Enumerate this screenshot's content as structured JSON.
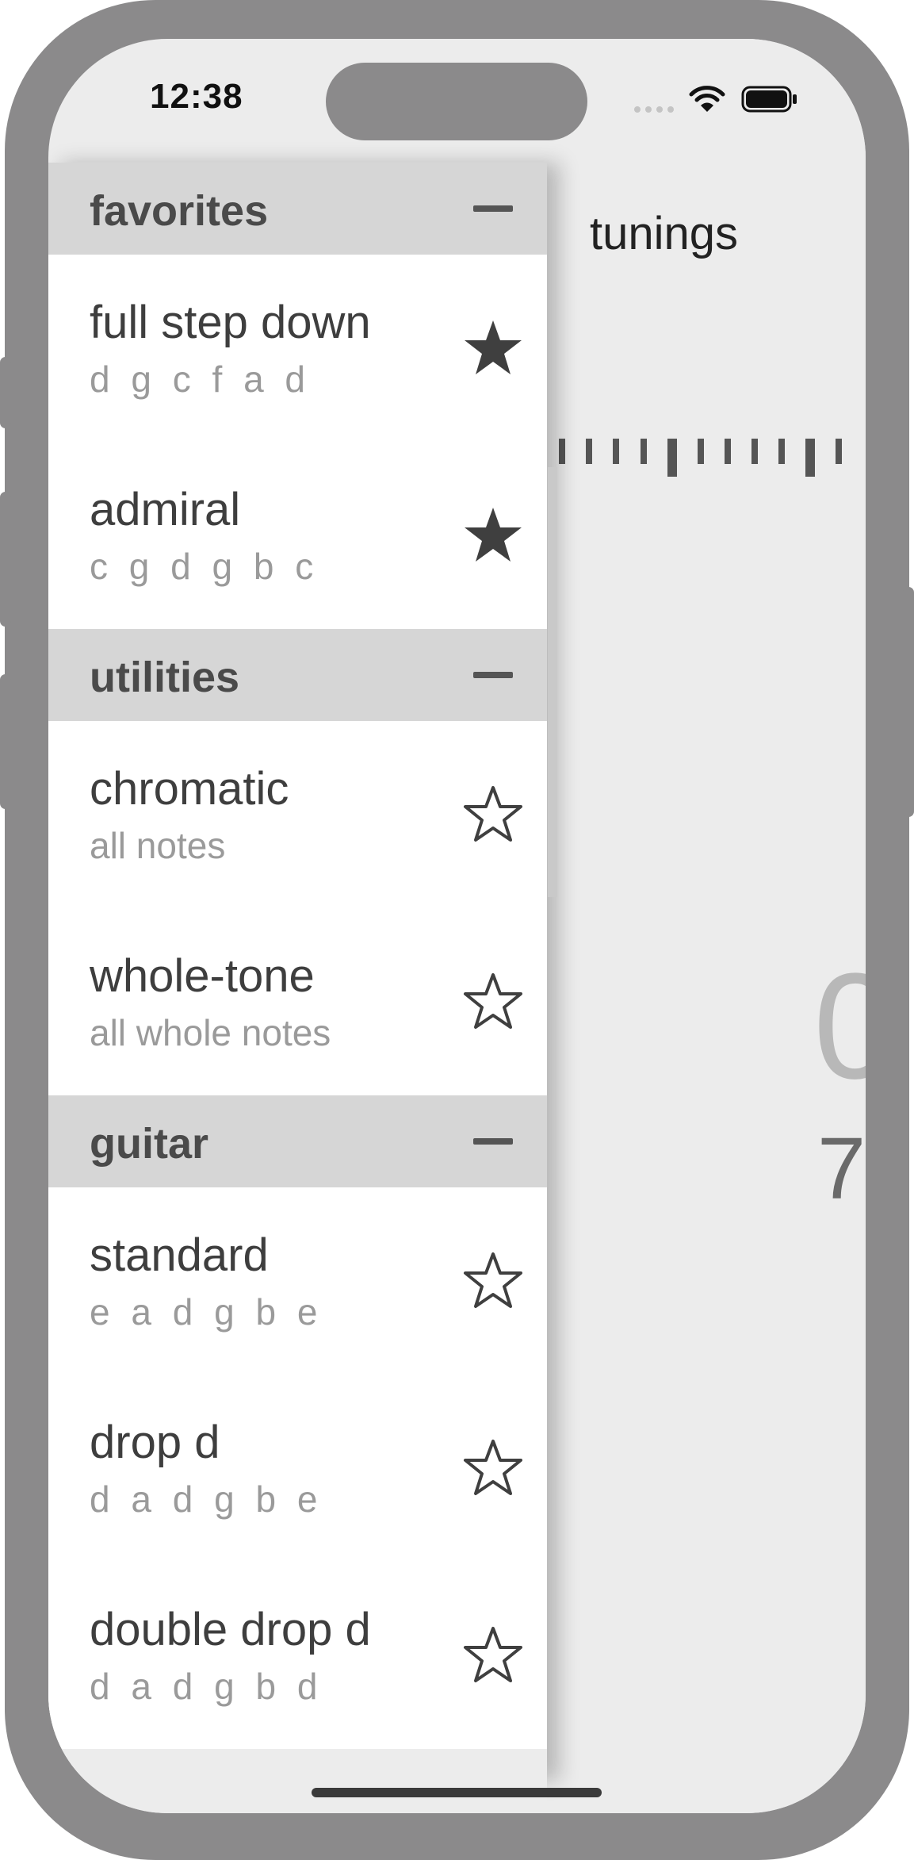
{
  "status_bar": {
    "time": "12:38",
    "icons": [
      "cellular-signal-icon",
      "wifi-icon",
      "battery-icon"
    ]
  },
  "main": {
    "title": "tunings",
    "note_partial": "0",
    "frequency_partial": "7"
  },
  "sections": [
    {
      "title": "favorites",
      "collapse_icon": "minus-icon",
      "items": [
        {
          "name": "full step down",
          "notes": "d g c f a d",
          "favorite": true
        },
        {
          "name": "admiral",
          "notes": "c g d g b c",
          "favorite": true
        }
      ]
    },
    {
      "title": "utilities",
      "collapse_icon": "minus-icon",
      "items": [
        {
          "name": "chromatic",
          "notes": "all notes",
          "favorite": false
        },
        {
          "name": "whole-tone",
          "notes": "all whole notes",
          "favorite": false
        }
      ]
    },
    {
      "title": "guitar",
      "collapse_icon": "minus-icon",
      "items": [
        {
          "name": "standard",
          "notes": "e a d g b e",
          "favorite": false
        },
        {
          "name": "drop d",
          "notes": "d a d g b e",
          "favorite": false
        },
        {
          "name": "double drop d",
          "notes": "d a d g b d",
          "favorite": false
        }
      ]
    }
  ],
  "colors": {
    "device_frame": "#8b8a8b",
    "screen_background": "#ececec",
    "section_header": "#d6d6d6",
    "star": "#3f3f3f"
  }
}
